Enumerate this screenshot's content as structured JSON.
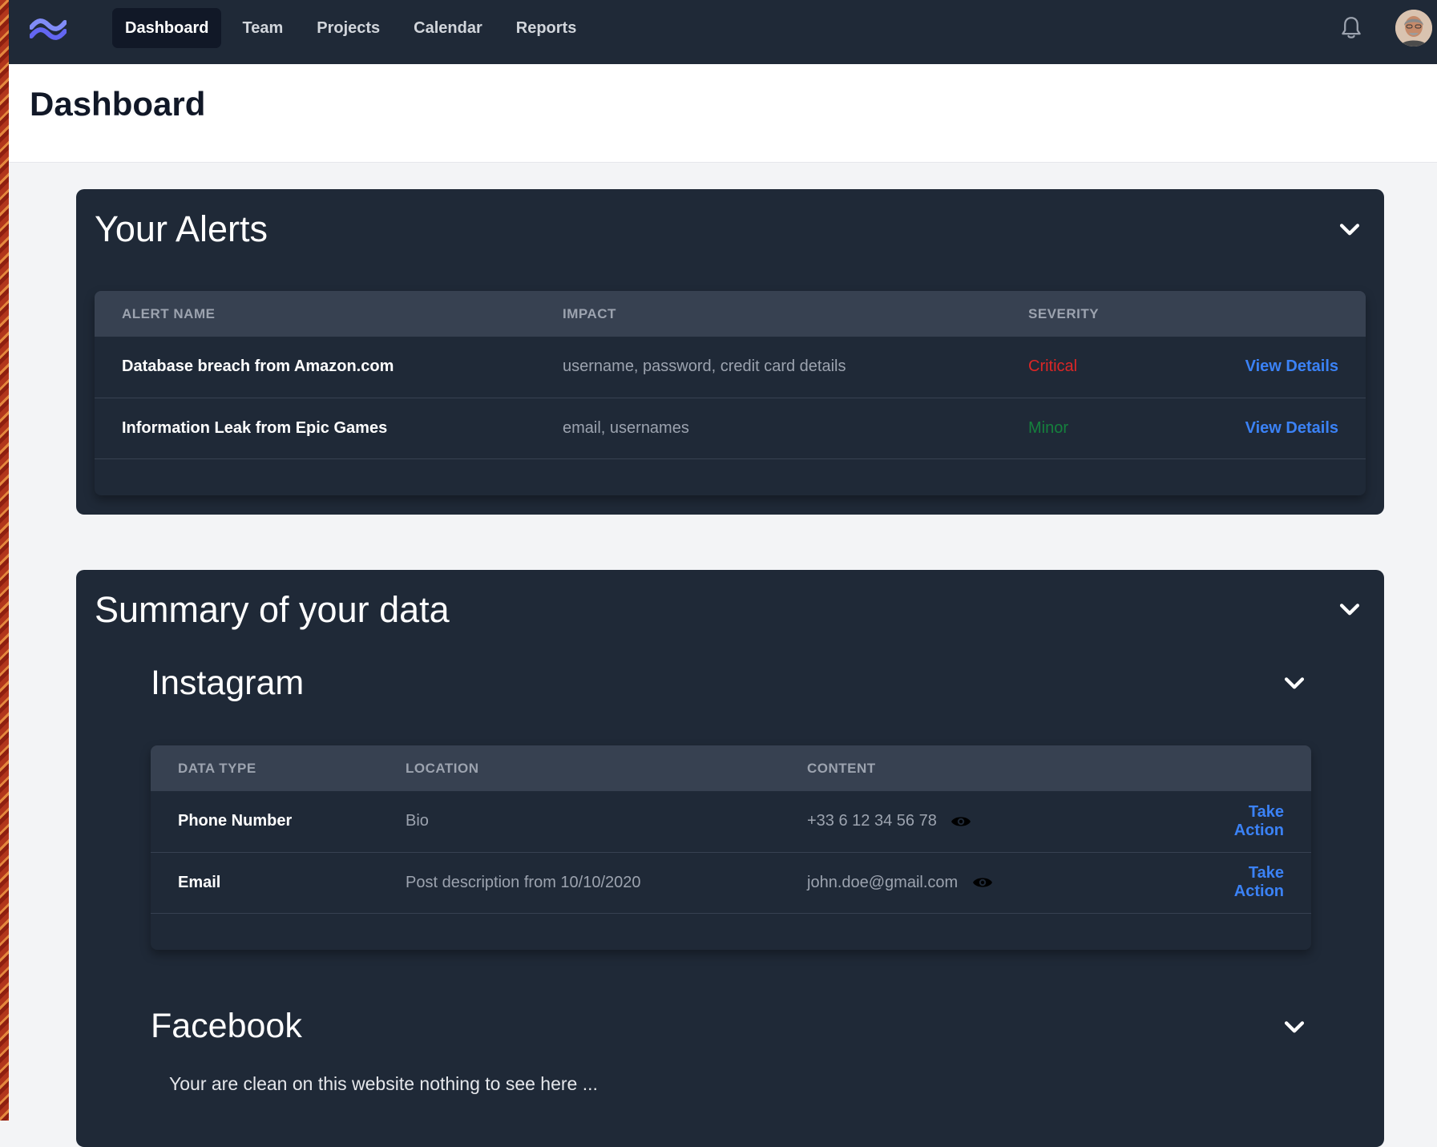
{
  "nav": {
    "items": [
      "Dashboard",
      "Team",
      "Projects",
      "Calendar",
      "Reports"
    ],
    "active": "Dashboard"
  },
  "icons": {
    "logo": "wave-logo-icon",
    "notifications": "bell-icon",
    "collapse": "chevron-down-icon",
    "reveal": "eye-icon"
  },
  "header": {
    "title": "Dashboard"
  },
  "alerts": {
    "title": "Your Alerts",
    "columns": [
      "ALERT NAME",
      "IMPACT",
      "SEVERITY"
    ],
    "rows": [
      {
        "name": "Database breach from Amazon.com",
        "impact": "username, password, credit card details",
        "severity": "Critical",
        "severity_color": "#dc2626",
        "action": "View Details"
      },
      {
        "name": "Information Leak from Epic Games",
        "impact": "email, usernames",
        "severity": "Minor",
        "severity_color": "#15803d",
        "action": "View Details"
      }
    ]
  },
  "summary": {
    "title": "Summary of your data",
    "instagram": {
      "title": "Instagram",
      "columns": [
        "DATA TYPE",
        "LOCATION",
        "CONTENT"
      ],
      "rows": [
        {
          "type": "Phone Number",
          "location": "Bio",
          "content": "+33 6 12 34 56 78",
          "action": "Take Action"
        },
        {
          "type": "Email",
          "location": "Post description from 10/10/2020",
          "content": "john.doe@gmail.com",
          "action": "Take Action"
        }
      ]
    },
    "facebook": {
      "title": "Facebook",
      "message": "Your are clean on this website nothing to see here ..."
    }
  },
  "colors": {
    "nav_bg": "#1f2937",
    "panel_bg": "#1f2937",
    "table_head_bg": "#374151",
    "page_bg": "#f3f4f6",
    "link": "#3b82f6",
    "critical": "#dc2626",
    "minor": "#15803d",
    "logo": "#818cf8"
  }
}
